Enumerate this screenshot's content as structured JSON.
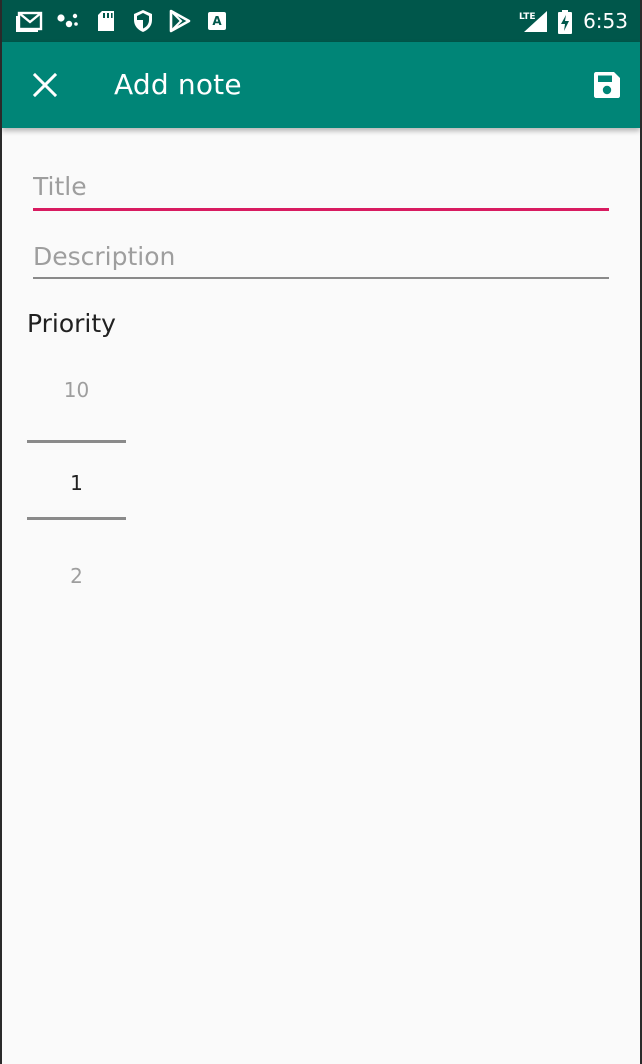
{
  "status_bar": {
    "icons": [
      "gmail-icon",
      "dots-icon",
      "sd-card-icon",
      "shield-icon",
      "play-store-icon",
      "text-a-icon",
      "lte-signal-icon",
      "battery-charging-icon"
    ],
    "network_label": "LTE",
    "time": "6:53",
    "background_color": "#00574b"
  },
  "toolbar": {
    "title": "Add note",
    "close_icon": "close-icon",
    "save_icon": "save-icon",
    "background_color": "#008577"
  },
  "form": {
    "title_placeholder": "Title",
    "title_value": "",
    "description_placeholder": "Description",
    "description_value": "",
    "accent_color": "#d81b60"
  },
  "priority": {
    "label": "Priority",
    "picker": {
      "previous": "10",
      "current": "1",
      "next": "2"
    }
  }
}
